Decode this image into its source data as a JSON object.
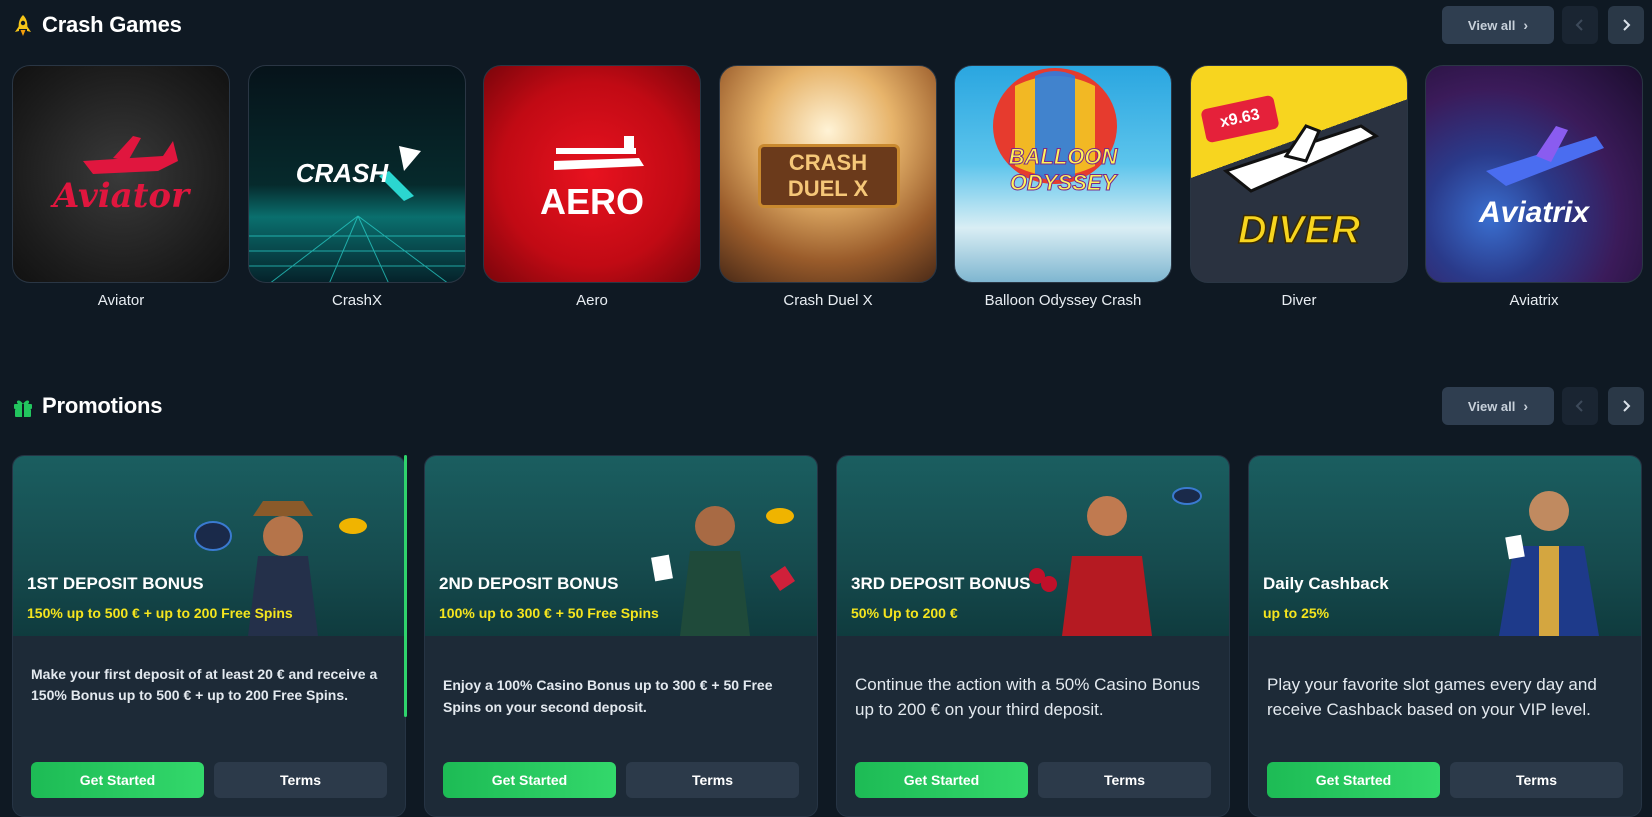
{
  "crash": {
    "title": "Crash Games",
    "view_all": "View all",
    "games": [
      {
        "name": "Aviator",
        "logo": "Aviator"
      },
      {
        "name": "CrashX",
        "logo": "CRASH"
      },
      {
        "name": "Aero",
        "logo": "AERO"
      },
      {
        "name": "Crash Duel X",
        "logo": "CRASH DUEL X"
      },
      {
        "name": "Balloon Odyssey Crash",
        "logo": "BALLOON ODYSSEY"
      },
      {
        "name": "Diver",
        "logo": "DIVER",
        "badge": "x9.63"
      },
      {
        "name": "Aviatrix",
        "logo": "Aviatrix"
      }
    ]
  },
  "promotions": {
    "title": "Promotions",
    "view_all": "View all",
    "items": [
      {
        "title": "1ST DEPOSIT BONUS",
        "subtitle": "150% up to 500 € + up to 200 Free Spins",
        "description": "Make your first deposit of at least 20 € and receive a 150% Bonus up to 500 € + up to 200 Free Spins.",
        "start": "Get Started",
        "terms": "Terms"
      },
      {
        "title": "2ND DEPOSIT BONUS",
        "subtitle": "100% up to 300 € + 50 Free Spins",
        "description": "Enjoy a 100% Casino Bonus up to 300 € + 50 Free Spins on your second deposit.",
        "start": "Get Started",
        "terms": "Terms"
      },
      {
        "title": "3RD DEPOSIT BONUS",
        "subtitle": "50% Up to 200 €",
        "description": "Continue the action with a 50% Casino Bonus up to 200 € on your third deposit.",
        "start": "Get Started",
        "terms": "Terms"
      },
      {
        "title": "Daily Cashback",
        "subtitle": "up to 25%",
        "description": "Play your favorite slot games every day and receive Cashback based on your VIP level.",
        "start": "Get Started",
        "terms": "Terms"
      }
    ]
  },
  "colors": {
    "background": "#0f1923",
    "accent_green": "#22c55e",
    "promo_subtitle": "#f5e51e"
  }
}
